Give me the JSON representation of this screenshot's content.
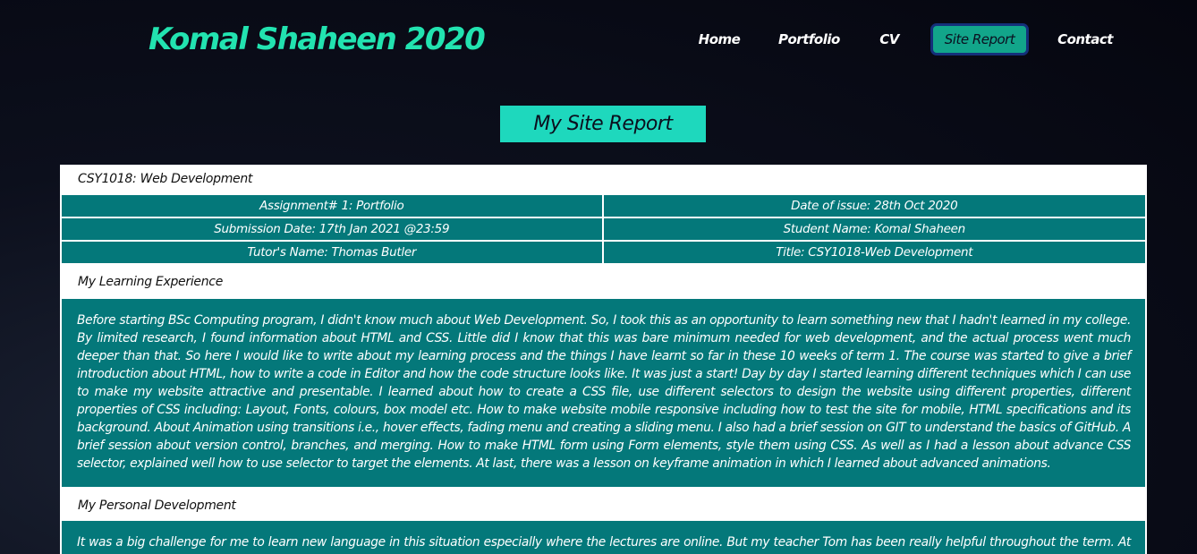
{
  "header": {
    "logo": "Komal Shaheen 2020",
    "nav": [
      "Home",
      "Portfolio",
      "CV",
      "Site Report",
      "Contact"
    ],
    "active_nav": "Site Report"
  },
  "page_title": "My Site Report",
  "report": {
    "module": "CSY1018: Web Development",
    "info_rows": [
      [
        "Assignment# 1: Portfolio",
        "Date of issue: 28th Oct 2020"
      ],
      [
        "Submission Date: 17th Jan 2021 @23:59",
        "Student Name: Komal Shaheen"
      ],
      [
        "Tutor's Name: Thomas Butler",
        "Title: CSY1018-Web Development"
      ]
    ],
    "learning_title": "My Learning Experience",
    "learning_text": "Before starting BSc Computing program, I didn't know much about Web Development. So, I took this as an opportunity to learn something new that I hadn't learned in my college. By limited research, I found information about HTML and CSS. Little did I know that this was bare minimum needed for web development, and the actual process went much deeper than that. So here I would like to write about my learning process and the things I have learnt so far in these 10 weeks of term 1. The course was started to give a brief introduction about HTML, how to write a code in Editor and how the code structure looks like. It was just a start! Day by day I started learning different techniques which I can use to make my website attractive and presentable. I learned about how to create a CSS file, use different selectors to design the website using different properties, different properties of CSS including: Layout, Fonts, colours, box model etc. How to make website mobile responsive including how to test the site for mobile, HTML specifications and its background. About Animation using transitions i.e., hover effects, fading menu and creating a sliding menu. I also had a brief session on GIT to understand the basics of GitHub. A brief session about version control, branches, and merging. How to make HTML form using Form elements, style them using CSS. As well as I had a lesson about advance CSS selector, explained well how to use selector to target the elements. At last, there was a lesson on keyframe animation in which I learned about advanced animations.",
    "personal_title": "My Personal Development",
    "personal_text": "It was a big challenge for me to learn new language in this situation especially where the lectures are online. But my teacher Tom has been really helpful throughout the term. At the"
  },
  "colors": {
    "accent": "#22e3b0",
    "title_box": "#1ed8bd",
    "teal": "#04787a",
    "active_nav_bg": "#12a58a",
    "active_nav_border": "#14307a"
  }
}
